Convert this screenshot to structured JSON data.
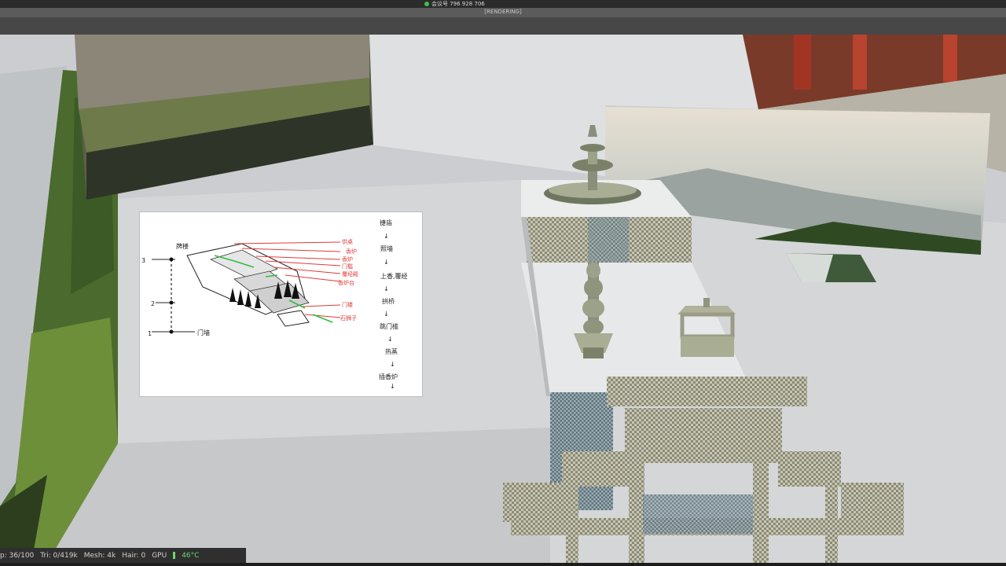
{
  "window": {
    "meeting_id": "会议号 796 928 706",
    "render_label": "[RENDERING]"
  },
  "status_bar": {
    "cap": "p: 36/100",
    "tri": "Tri: 0/419k",
    "mesh": "Mesh: 4k",
    "hair": "Hair: 0",
    "gpu_label": "GPU",
    "gpu_temp": "46°C"
  },
  "reference_sketch": {
    "flow": [
      "捷庙",
      "↓",
      "照墙",
      "↓",
      "上香,覆经",
      "↓",
      "拱桥",
      "↓",
      "跳门槛",
      "↓",
      "热蒸",
      "↓",
      "插香炉",
      "↓"
    ],
    "left_labels": [
      "牌楼",
      "3",
      "2",
      "1",
      "门墙"
    ],
    "red_labels": [
      "供桌",
      "香炉",
      "香炉",
      "门槛",
      "覆经殿",
      "香炉台",
      "门楼",
      "石狮子"
    ]
  },
  "colors": {
    "accent_red": "#e03a3a",
    "accent_green": "#2fbf3f",
    "gpu_green": "#6fd46f"
  }
}
